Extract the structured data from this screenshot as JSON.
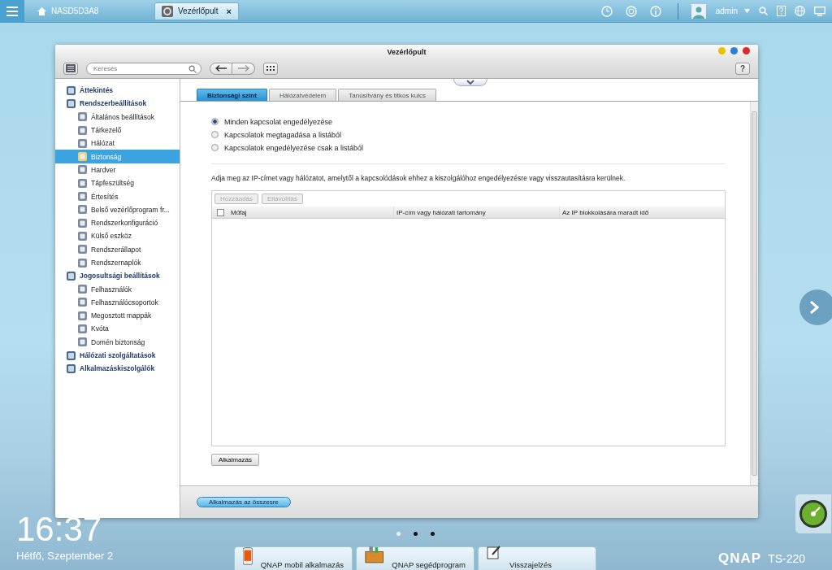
{
  "top_bar": {
    "tabs": [
      {
        "label": "NASD5D3A8",
        "selected": false
      },
      {
        "label": "Vezérlőpult",
        "selected": true,
        "close": "×"
      }
    ],
    "user": "admin"
  },
  "window": {
    "title": "Vezérlőpult",
    "search": {
      "placeholder": "Keresés"
    },
    "help": "?"
  },
  "sidebar": {
    "items": [
      {
        "label": "Áttekintés",
        "selected": false
      },
      {
        "label": "Rendszerbeállítások",
        "selected": false,
        "children": [
          {
            "label": "Általános beállítások",
            "selected": false
          },
          {
            "label": "Tárkezelő",
            "selected": false
          },
          {
            "label": "Hálózat",
            "selected": false
          },
          {
            "label": "Biztonság",
            "selected": true
          },
          {
            "label": "Hardver",
            "selected": false
          },
          {
            "label": "Tápfeszültség",
            "selected": false
          },
          {
            "label": "Értesítés",
            "selected": false
          },
          {
            "label": "Belső vezérlőprogram fr...",
            "selected": false
          },
          {
            "label": "Rendszerkonfiguráció",
            "selected": false
          },
          {
            "label": "Külső eszköz",
            "selected": false
          },
          {
            "label": "Rendszerállapot",
            "selected": false
          },
          {
            "label": "Rendszernaplók",
            "selected": false
          }
        ]
      },
      {
        "label": "Jogosultsági beállítások",
        "selected": false,
        "children": [
          {
            "label": "Felhasználók",
            "selected": false
          },
          {
            "label": "Felhasználócsoportok",
            "selected": false
          },
          {
            "label": "Megosztott mappák",
            "selected": false
          },
          {
            "label": "Kvóta",
            "selected": false
          },
          {
            "label": "Domén biztonság",
            "selected": false
          }
        ]
      },
      {
        "label": "Hálózati szolgáltatások",
        "selected": false
      },
      {
        "label": "Alkalmazáskiszolgálók",
        "selected": false
      }
    ]
  },
  "tabs": [
    {
      "label": "Biztonsági szint",
      "selected": true
    },
    {
      "label": "Hálózatvédelem",
      "selected": false
    },
    {
      "label": "Tanúsítvány és titkos kulcs",
      "selected": false
    }
  ],
  "options": [
    {
      "label": "Minden kapcsolat engedélyezése",
      "selected": true
    },
    {
      "label": "Kapcsolatok megtagadása a listából",
      "selected": false
    },
    {
      "label": "Kapcsolatok engedélyezése csak a listából",
      "selected": false
    }
  ],
  "description": "Adja meg az IP-címet vagy hálózatot, amelytől a kapcsolódások ehhez a kiszolgálóhoz engedélyezésre vagy visszautasításra kerülnek.",
  "table": {
    "buttons": [
      {
        "label": "Hozzáadás",
        "disabled": true
      },
      {
        "label": "Eltávolítás",
        "disabled": true
      }
    ],
    "select_all": {
      "checked": false
    },
    "columns": [
      "Műfaj",
      "IP-cím vagy hálózati tartomány",
      "Az IP blokkolására maradt idő"
    ]
  },
  "apply_button": "Alkalmazás",
  "apply_all_button": "Alkalmazás az összesre",
  "desktop": {
    "time": "16:37",
    "date": "Hétfő, Szeptember 2",
    "pages": [
      {
        "selected": true
      },
      {
        "selected": false
      },
      {
        "selected": false
      }
    ],
    "dock": [
      "QNAP mobil alkalmazás",
      "QNAP segédprogram",
      "Visszajelzés"
    ],
    "brand": "QNAP",
    "model": "TS-220"
  }
}
